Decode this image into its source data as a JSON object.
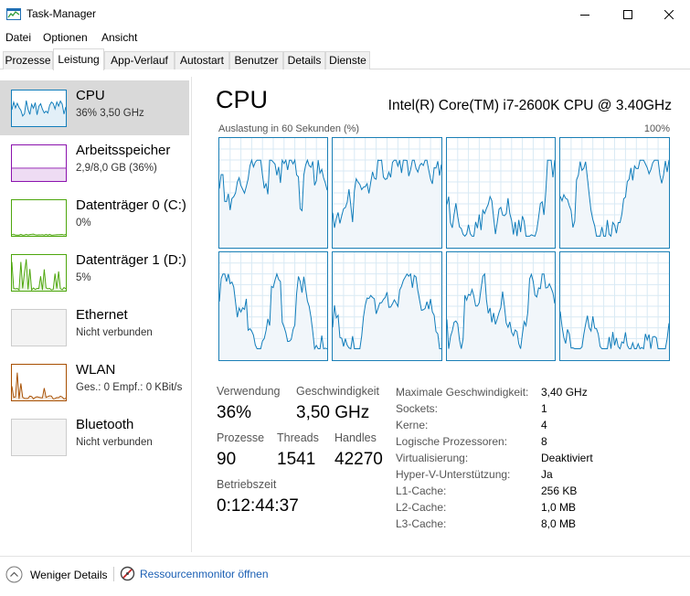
{
  "window": {
    "title": "Task-Manager"
  },
  "menu": [
    "Datei",
    "Optionen",
    "Ansicht"
  ],
  "tabs": [
    "Prozesse",
    "Leistung",
    "App-Verlauf",
    "Autostart",
    "Benutzer",
    "Details",
    "Dienste"
  ],
  "active_tab": "Leistung",
  "sidebar": [
    {
      "title": "CPU",
      "subtitle": "36% 3,50 GHz",
      "color": "#117dbb"
    },
    {
      "title": "Arbeitsspeicher",
      "subtitle": "2,9/8,0 GB (36%)",
      "color": "#8b12ae",
      "fill": 0.36
    },
    {
      "title": "Datenträger 0 (C:)",
      "subtitle": "0%",
      "color": "#4da60c"
    },
    {
      "title": "Datenträger 1 (D:)",
      "subtitle": "5%",
      "color": "#4da60c"
    },
    {
      "title": "Ethernet",
      "subtitle": "Nicht verbunden",
      "color": "#a0a0a0"
    },
    {
      "title": "WLAN",
      "subtitle": "Ges.: 0 Empf.: 0 KBit/s",
      "color": "#a74f01"
    },
    {
      "title": "Bluetooth",
      "subtitle": "Nicht verbunden",
      "color": "#a0a0a0"
    }
  ],
  "cpu": {
    "title": "CPU",
    "model": "Intel(R) Core(TM) i7-2600K CPU @ 3.40GHz",
    "graph_caption": "Auslastung in 60 Sekunden (%)",
    "graph_max": "100%",
    "graph_color": "#117dbb"
  },
  "stats": {
    "usage_label": "Verwendung",
    "usage_value": "36%",
    "speed_label": "Geschwindigkeit",
    "speed_value": "3,50 GHz",
    "processes_label": "Prozesse",
    "processes_value": "90",
    "threads_label": "Threads",
    "threads_value": "1541",
    "handles_label": "Handles",
    "handles_value": "42270",
    "uptime_label": "Betriebszeit",
    "uptime_value": "0:12:44:37"
  },
  "specs": [
    {
      "label": "Maximale Geschwindigkeit:",
      "value": "3,40 GHz"
    },
    {
      "label": "Sockets:",
      "value": "1"
    },
    {
      "label": "Kerne:",
      "value": "4"
    },
    {
      "label": "Logische Prozessoren:",
      "value": "8"
    },
    {
      "label": "Virtualisierung:",
      "value": "Deaktiviert"
    },
    {
      "label": "Hyper-V-Unterstützung:",
      "value": "Ja"
    },
    {
      "label": "L1-Cache:",
      "value": "256 KB"
    },
    {
      "label": "L2-Cache:",
      "value": "1,0 MB"
    },
    {
      "label": "L3-Cache:",
      "value": "8,0 MB"
    }
  ],
  "footer": {
    "fewer_details": "Weniger Details",
    "resource_monitor": "Ressourcenmonitor öffnen"
  }
}
